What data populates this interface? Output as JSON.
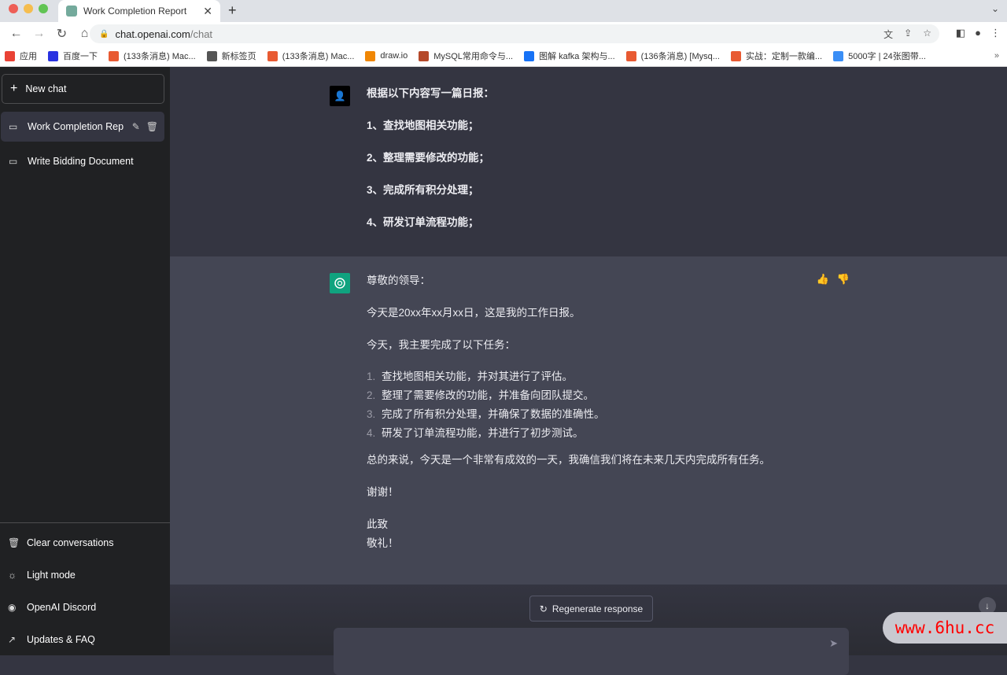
{
  "browser": {
    "tab_title": "Work Completion Report",
    "url_host": "chat.openai.com",
    "url_path": "/chat",
    "bookmarks": [
      {
        "label": "应用",
        "icon": "apps-grid-icon",
        "color": "#e94235"
      },
      {
        "label": "百度一下",
        "icon": "baidu-paw-icon",
        "color": "#2932e1"
      },
      {
        "label": "(133条消息) Mac...",
        "icon": "csdn-icon",
        "color": "#e85a32"
      },
      {
        "label": "新标签页",
        "icon": "globe-icon",
        "color": "#555555"
      },
      {
        "label": "(133条消息) Mac...",
        "icon": "csdn-icon",
        "color": "#e85a32"
      },
      {
        "label": "draw.io",
        "icon": "drawio-icon",
        "color": "#f08705"
      },
      {
        "label": "MySQL常用命令与...",
        "icon": "bookmark-b-icon",
        "color": "#b5492a"
      },
      {
        "label": "图解 kafka 架构与...",
        "icon": "zhihu-icon",
        "color": "#1772f6"
      },
      {
        "label": "(136条消息) [Mysq...",
        "icon": "csdn-icon",
        "color": "#e85a32"
      },
      {
        "label": "实战：定制一款编...",
        "icon": "csdn-icon",
        "color": "#e85a32"
      },
      {
        "label": "5000字 | 24张图带...",
        "icon": "cloud-icon",
        "color": "#3a8ef6"
      }
    ]
  },
  "sidebar": {
    "new_chat": "New chat",
    "conversations": [
      {
        "label": "Work Completion Rep"
      },
      {
        "label": "Write Bidding Document"
      }
    ],
    "bottom": [
      {
        "label": "Clear conversations"
      },
      {
        "label": "Light mode"
      },
      {
        "label": "OpenAI Discord"
      },
      {
        "label": "Updates & FAQ"
      }
    ]
  },
  "user_message": [
    "根据以下内容写一篇日报：",
    "1、查找地图相关功能；",
    "2、整理需要修改的功能；",
    "3、完成所有积分处理；",
    "4、研发订单流程功能；"
  ],
  "assistant_message": {
    "greeting": "尊敬的领导：",
    "p1": "今天是20xx年xx月xx日，这是我的工作日报。",
    "p2": "今天，我主要完成了以下任务：",
    "list": [
      {
        "n": "1.",
        "t": "查找地图相关功能，并对其进行了评估。"
      },
      {
        "n": "2.",
        "t": "整理了需要修改的功能，并准备向团队提交。"
      },
      {
        "n": "3.",
        "t": "完成了所有积分处理，并确保了数据的准确性。"
      },
      {
        "n": "4.",
        "t": "研发了订单流程功能，并进行了初步测试。"
      }
    ],
    "p3": "总的来说，今天是一个非常有成效的一天，我确信我们将在未来几天内完成所有任务。",
    "p4": "谢谢！",
    "p5": "此致",
    "p6": "敬礼！"
  },
  "regenerate": "Regenerate response",
  "input_placeholder": "",
  "watermark": "www.6hu.cc",
  "colors": {
    "sidebar": "#202123",
    "user_bg": "#343541",
    "assistant_bg": "#444654",
    "accent": "#10a37f"
  }
}
